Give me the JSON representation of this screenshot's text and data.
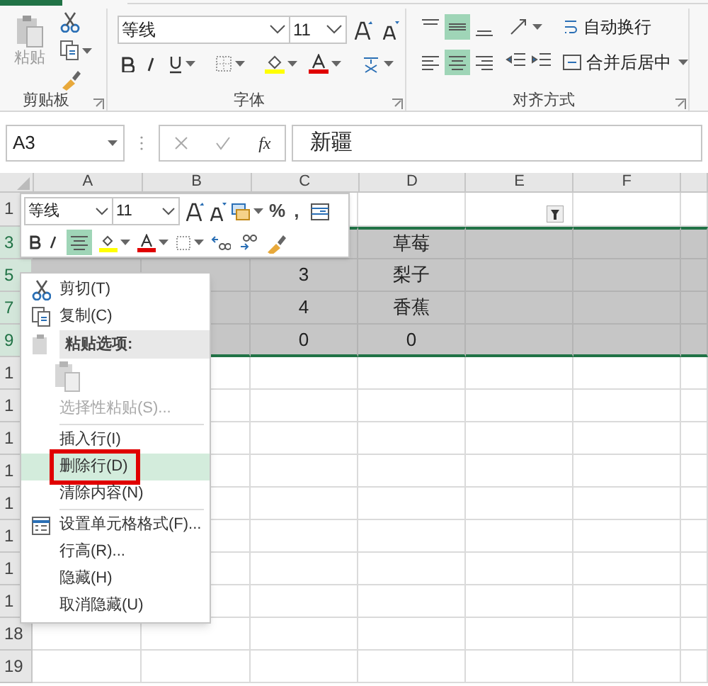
{
  "ribbon": {
    "clipboard": {
      "paste_label": "粘贴",
      "label": "剪贴板"
    },
    "font": {
      "font_name": "等线",
      "font_size": "11",
      "label": "字体"
    },
    "alignment": {
      "label": "对齐方式",
      "wrap_text": "自动换行",
      "merge_center": "合并后居中",
      "buttons": [
        {
          "kind": "top",
          "selected": false
        },
        {
          "kind": "middle",
          "selected": true
        },
        {
          "kind": "bottom",
          "selected": false
        },
        {
          "kind": "left",
          "selected": false
        },
        {
          "kind": "center",
          "selected": true
        },
        {
          "kind": "right",
          "selected": false
        }
      ]
    }
  },
  "formula_bar": {
    "name_box": "A3",
    "function_label": "fx",
    "value": "新疆"
  },
  "grid": {
    "columns": [
      "A",
      "B",
      "C",
      "D",
      "E",
      "F"
    ],
    "rows": [
      {
        "header": "1",
        "selected": false,
        "cells": []
      },
      {
        "header": "3",
        "selected": true,
        "cells": [
          {
            "kind": "empty"
          },
          {
            "kind": "empty"
          },
          {
            "kind": "empty"
          },
          {
            "kind": "text",
            "text": "草莓"
          }
        ]
      },
      {
        "header": "5",
        "selected": true,
        "cells": [
          {
            "kind": "empty"
          },
          {
            "kind": "empty"
          },
          {
            "kind": "text",
            "text": "3"
          },
          {
            "kind": "text",
            "text": "梨子"
          }
        ]
      },
      {
        "header": "7",
        "selected": true,
        "cells": [
          {
            "kind": "empty"
          },
          {
            "kind": "empty"
          },
          {
            "kind": "text",
            "text": "4"
          },
          {
            "kind": "text",
            "text": "香蕉"
          }
        ]
      },
      {
        "header": "9",
        "selected": true,
        "cells": [
          {
            "kind": "empty"
          },
          {
            "kind": "empty"
          },
          {
            "kind": "text",
            "text": "0"
          },
          {
            "kind": "text",
            "text": "0"
          }
        ]
      },
      {
        "header": "1",
        "selected": false,
        "cells": []
      },
      {
        "header": "1",
        "selected": false,
        "cells": []
      },
      {
        "header": "1",
        "selected": false,
        "cells": []
      },
      {
        "header": "1",
        "selected": false,
        "cells": []
      },
      {
        "header": "1",
        "selected": false,
        "cells": []
      },
      {
        "header": "1",
        "selected": false,
        "cells": []
      },
      {
        "header": "1",
        "selected": false,
        "cells": []
      },
      {
        "header": "1",
        "selected": false,
        "cells": []
      },
      {
        "header": "18",
        "selected": false,
        "cells": []
      },
      {
        "header": "19",
        "selected": false,
        "cells": []
      }
    ]
  },
  "mini_toolbar": {
    "font_name": "等线",
    "font_size": "11",
    "percent": "%",
    "comma": ",",
    "center_selected": true
  },
  "context_menu": [
    {
      "kind": "cut",
      "text": "剪切(T)",
      "selected": false,
      "disabled": false,
      "marked": false
    },
    {
      "kind": "copy",
      "text": "复制(C)",
      "selected": false,
      "disabled": false,
      "marked": false
    },
    {
      "kind": "paste_header",
      "text": "粘贴选项:"
    },
    {
      "kind": "paste_option"
    },
    {
      "kind": "command",
      "text": "选择性粘贴(S)...",
      "selected": false,
      "disabled": true,
      "marked": false
    },
    {
      "kind": "separator"
    },
    {
      "kind": "command",
      "text": "插入行(I)",
      "selected": false,
      "disabled": false,
      "marked": false
    },
    {
      "kind": "command",
      "text": "删除行(D)",
      "selected": true,
      "disabled": false,
      "marked": true
    },
    {
      "kind": "command",
      "text": "清除内容(N)",
      "selected": false,
      "disabled": false,
      "marked": false
    },
    {
      "kind": "separator"
    },
    {
      "kind": "format",
      "text": "设置单元格格式(F)...",
      "selected": false,
      "disabled": false,
      "marked": false
    },
    {
      "kind": "command",
      "text": "行高(R)...",
      "selected": false,
      "disabled": false,
      "marked": false
    },
    {
      "kind": "command",
      "text": "隐藏(H)",
      "selected": false,
      "disabled": false,
      "marked": false
    },
    {
      "kind": "command",
      "text": "取消隐藏(U)",
      "selected": false,
      "disabled": false,
      "marked": false
    }
  ]
}
